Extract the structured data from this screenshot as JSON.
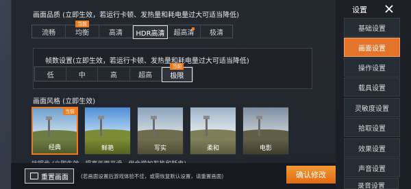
{
  "quality": {
    "title": "画面品质 (立即生效，若运行卡顿、发热量和耗电量过大可适当降低)",
    "options": [
      {
        "label": "流畅",
        "badge": ""
      },
      {
        "label": "均衡",
        "badge": "当前"
      },
      {
        "label": "高清",
        "badge": ""
      },
      {
        "label": "HDR高清",
        "badge": ""
      },
      {
        "label": "超高清",
        "badge": ""
      },
      {
        "label": "极清",
        "badge": ""
      }
    ],
    "selected": "HDR高清"
  },
  "fps": {
    "title": "帧数设置(立即生效，若运行卡顿、发热量和耗电量过大可适当降低)",
    "options": [
      {
        "label": "低",
        "badge": ""
      },
      {
        "label": "中",
        "badge": ""
      },
      {
        "label": "高",
        "badge": ""
      },
      {
        "label": "超高",
        "badge": ""
      },
      {
        "label": "极限",
        "badge": "当前"
      }
    ],
    "selected": "极限"
  },
  "style": {
    "title": "画面风格 (立即生效)",
    "options": [
      {
        "label": "经典",
        "badge": "当前"
      },
      {
        "label": "鲜艳",
        "badge": ""
      },
      {
        "label": "写实",
        "badge": ""
      },
      {
        "label": "柔和",
        "badge": ""
      },
      {
        "label": "电影",
        "badge": ""
      }
    ],
    "selected": "经典"
  },
  "hint": "抗锯齿 (立即生效，提高画面平滑，但会增加发热和耗电)",
  "footer": {
    "reset_label": "重置画面",
    "note": "(若画面设置后游戏体验不佳，或需恢复默认设置，请重置画面)",
    "confirm_label": "确认修改"
  },
  "sidebar": {
    "title": "设置",
    "items": [
      {
        "label": "基础设置"
      },
      {
        "label": "画面设置"
      },
      {
        "label": "操作设置"
      },
      {
        "label": "载具设置"
      },
      {
        "label": "灵敏度设置"
      },
      {
        "label": "拾取设置"
      },
      {
        "label": "效果设置"
      },
      {
        "label": "声音设置"
      },
      {
        "label": "录音设置"
      }
    ],
    "selected": "画面设置"
  },
  "colors": {
    "accent": "#f07a1f",
    "selected_nav": "#e4742a"
  }
}
